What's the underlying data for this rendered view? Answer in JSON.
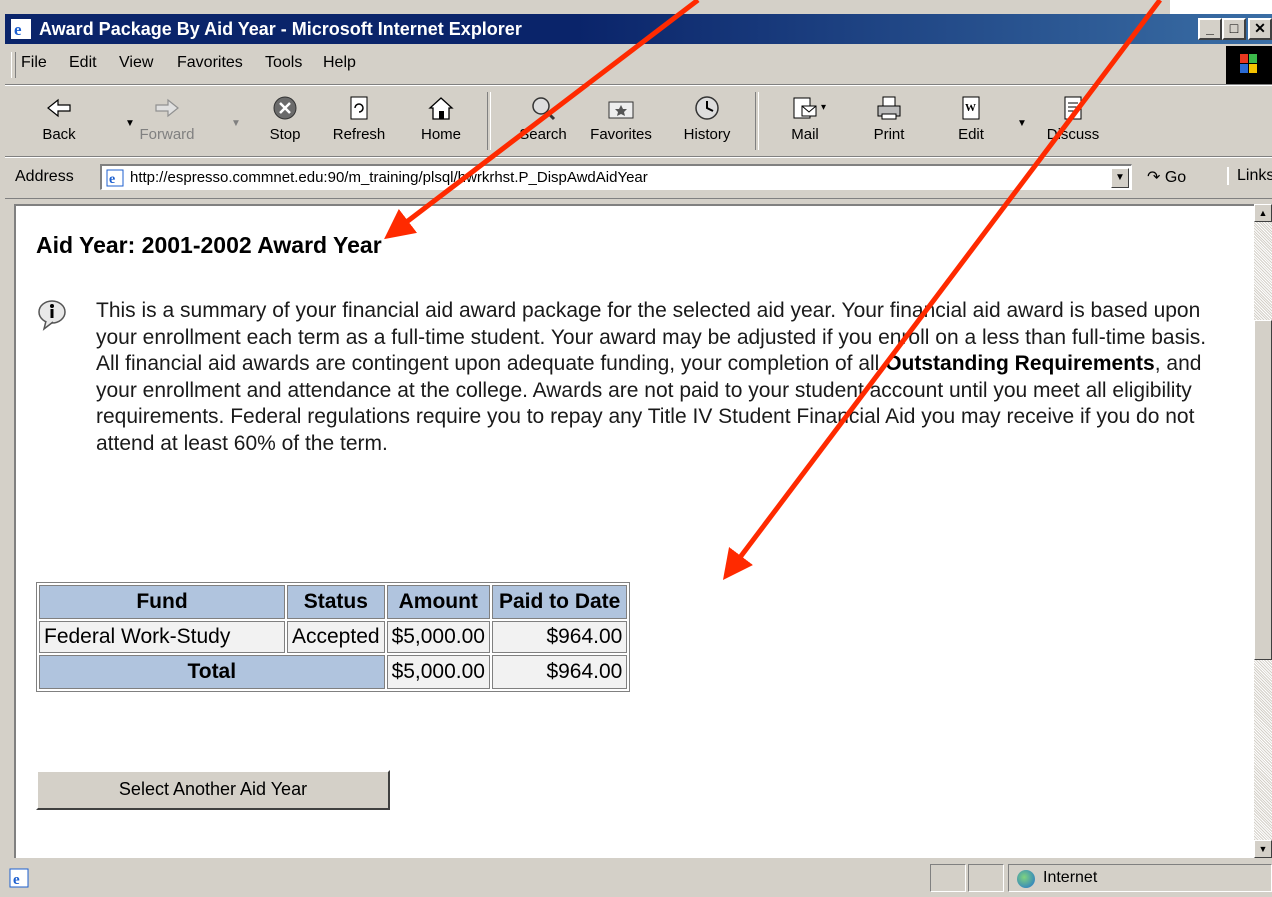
{
  "window": {
    "title": "Award Package By Aid Year - Microsoft Internet Explorer"
  },
  "menu": [
    "File",
    "Edit",
    "View",
    "Favorites",
    "Tools",
    "Help"
  ],
  "toolbar": {
    "back": "Back",
    "forward": "Forward",
    "stop": "Stop",
    "refresh": "Refresh",
    "home": "Home",
    "search": "Search",
    "favorites": "Favorites",
    "history": "History",
    "mail": "Mail",
    "print": "Print",
    "edit": "Edit",
    "discuss": "Discuss"
  },
  "address": {
    "label": "Address",
    "url": "http://espresso.commnet.edu:90/m_training/plsql/hwrkrhst.P_DispAwdAidYear",
    "go": "Go",
    "links": "Links"
  },
  "page": {
    "heading": "Aid Year: 2001-2002 Award Year",
    "info_part1": "This is a summary of your financial aid award package for the selected aid year. Your financial aid award is based upon your enrollment each term as a full-time student. Your award may be adjusted if you enroll on a less than full-time basis. All financial aid awards are contingent upon adequate funding, your completion of all ",
    "info_bold": "Outstanding Requirements",
    "info_part2": ", and your enrollment and attendance at the college. Awards are not paid to your student account until you meet all eligibility requirements. Federal regulations require you to repay any Title IV Student Financial Aid you may receive if you do not attend at least 60% of the term.",
    "table": {
      "headers": [
        "Fund",
        "Status",
        "Amount",
        "Paid to Date"
      ],
      "row": {
        "fund": "Federal Work-Study",
        "status": "Accepted",
        "amount": "$5,000.00",
        "paid": "$964.00"
      },
      "total": {
        "label": "Total",
        "amount": "$5,000.00",
        "paid": "$964.00"
      }
    },
    "select_button": "Select Another Aid Year"
  },
  "status": {
    "zone": "Internet"
  },
  "colors": {
    "arrow": "#ff2a00",
    "header_bg": "#b0c4de",
    "titlebar": "#0a246a"
  }
}
